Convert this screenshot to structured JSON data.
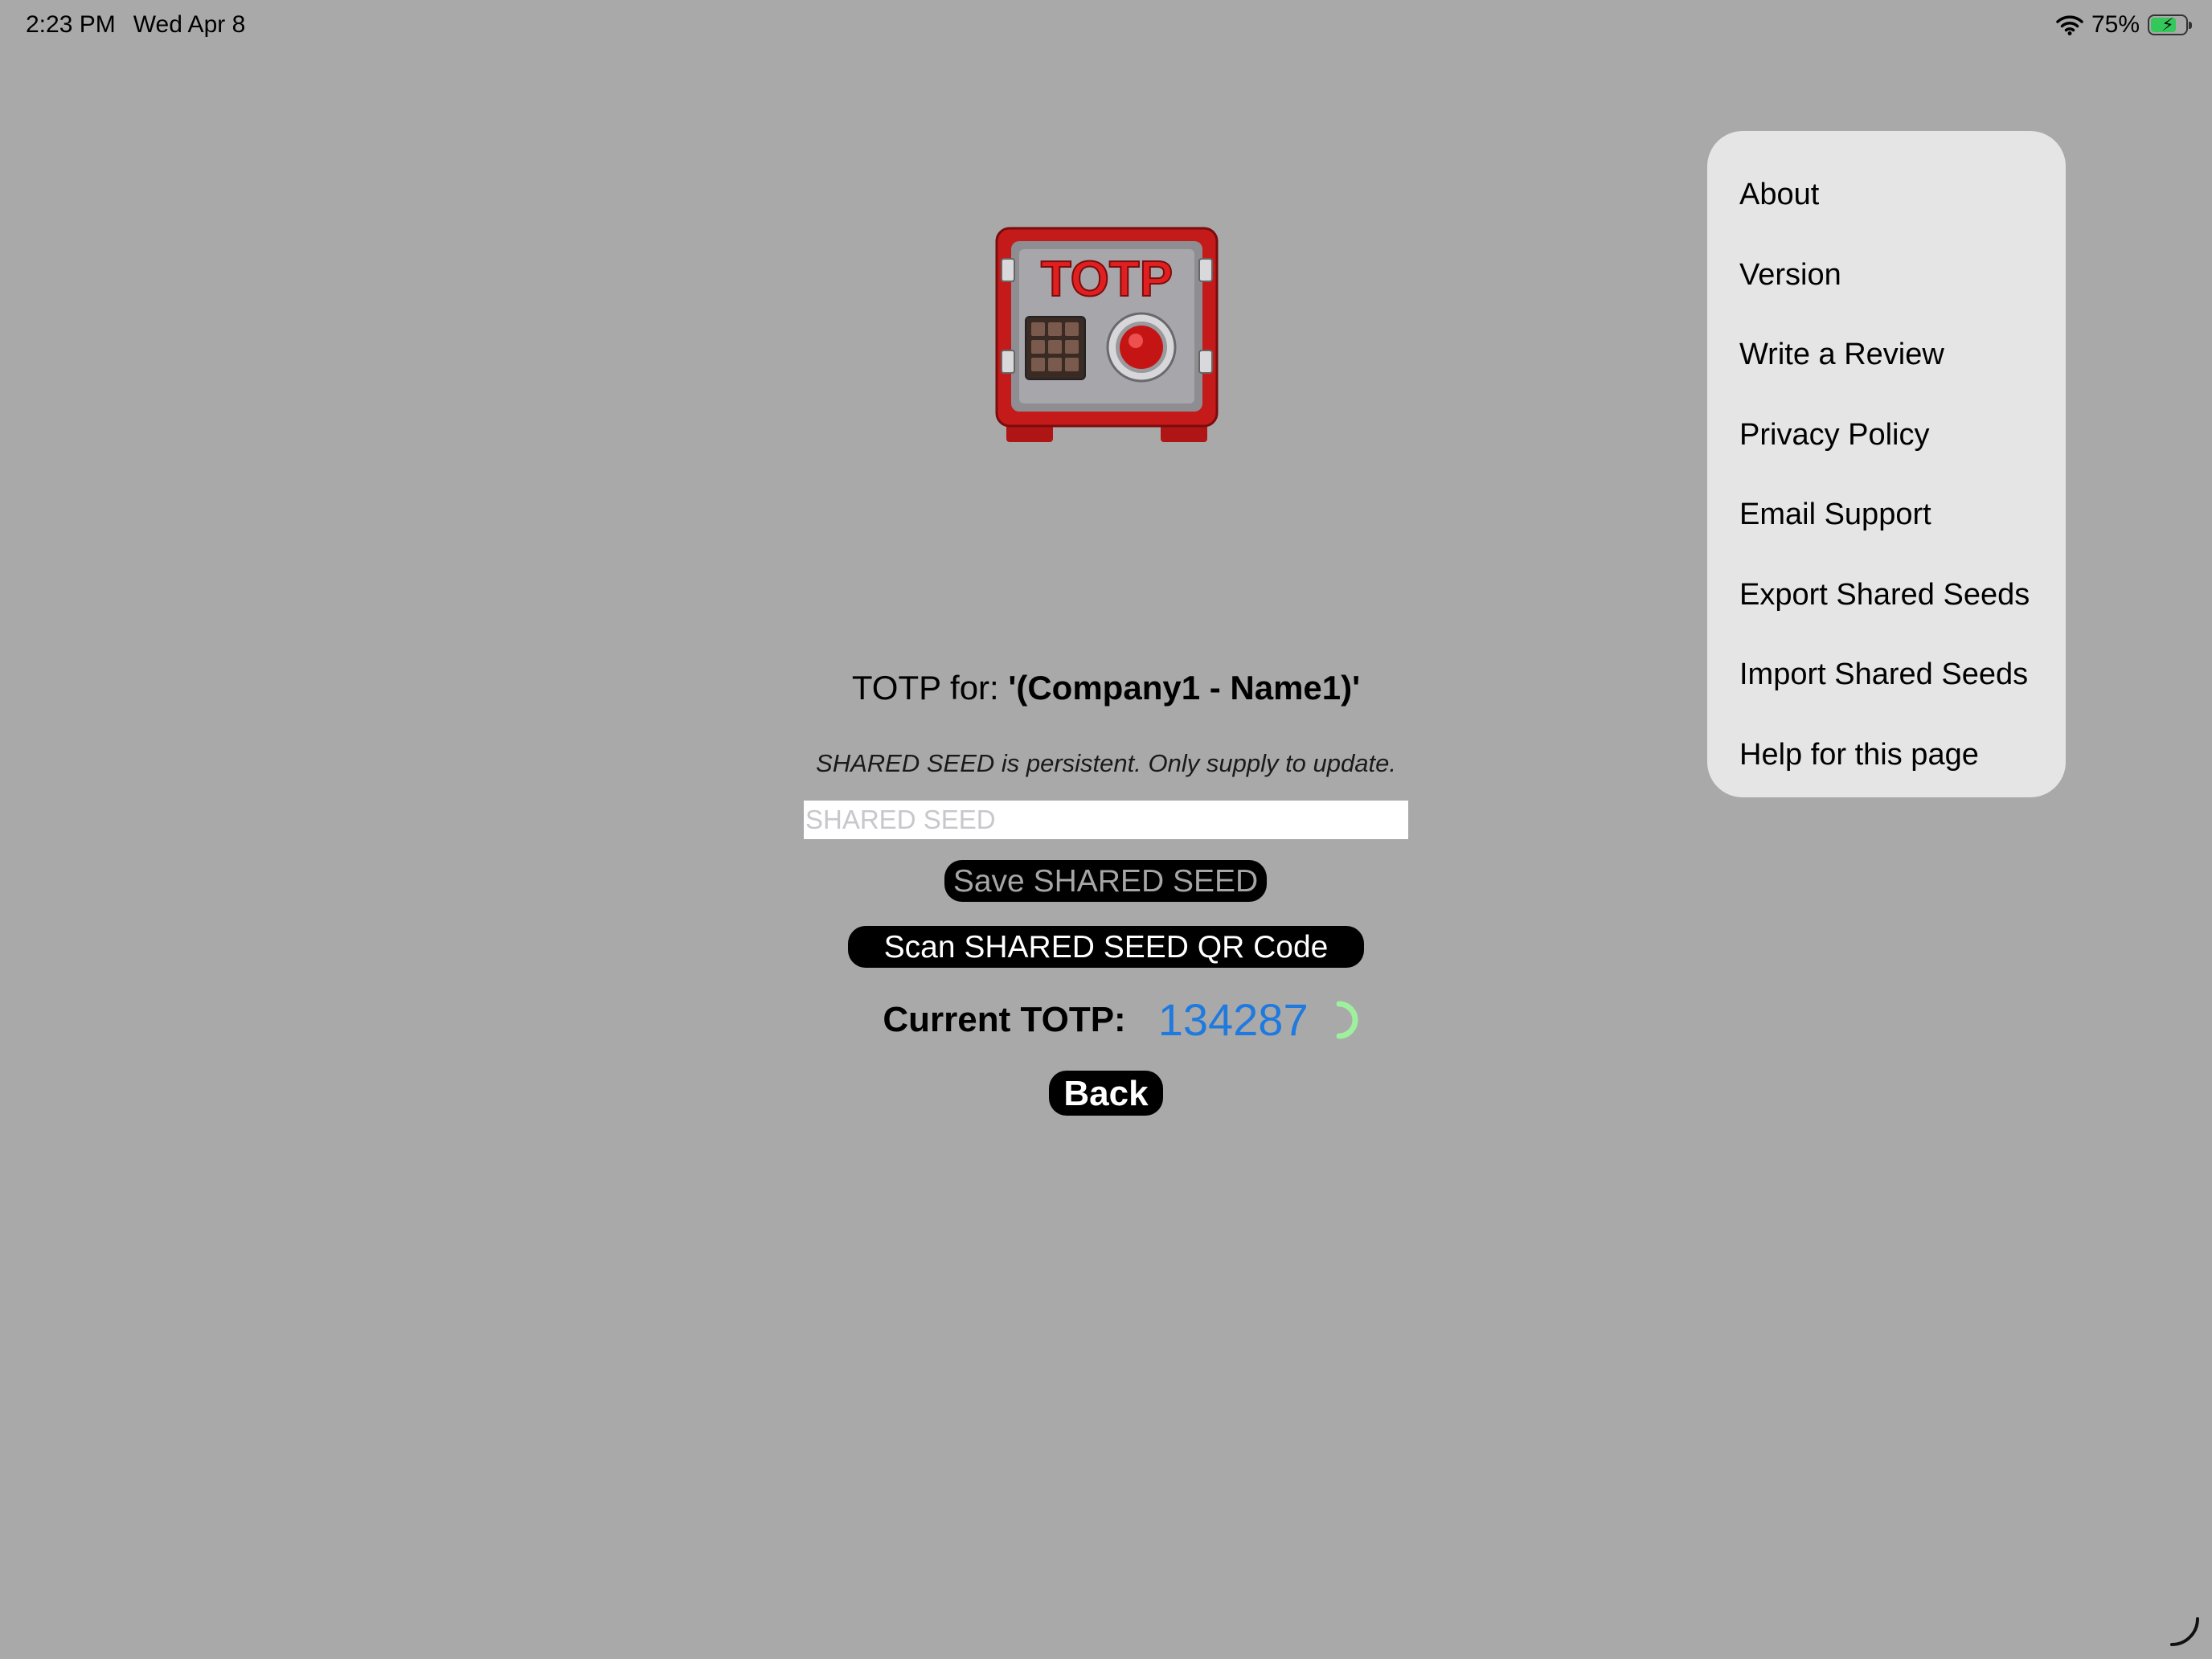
{
  "status_bar": {
    "time": "2:23 PM",
    "date": "Wed Apr 8",
    "battery_percent": "75%",
    "battery_level": 0.75,
    "battery_color": "#34c759",
    "wifi_icon": "wifi-icon",
    "charging_icon": "bolt-icon"
  },
  "logo": {
    "text": "TOTP",
    "icon": "safe-icon"
  },
  "header": {
    "prefix": "TOTP for: ",
    "account": "'(Company1 - Name1)'"
  },
  "seed": {
    "note": "SHARED SEED is persistent. Only supply to update.",
    "placeholder": "SHARED SEED",
    "value": ""
  },
  "buttons": {
    "save": "Save SHARED SEED",
    "scan": "Scan SHARED SEED QR Code",
    "back": "Back"
  },
  "totp": {
    "label": "Current TOTP:",
    "code": "134287",
    "code_color": "#1f7ae0",
    "timer_icon": "countdown-ring-icon",
    "timer_color": "#9ef09e"
  },
  "menu": {
    "items": [
      "About",
      "Version",
      "Write a Review",
      "Privacy Policy",
      "Email Support",
      "Export Shared Seeds",
      "Import Shared Seeds",
      "Help for this page"
    ]
  }
}
